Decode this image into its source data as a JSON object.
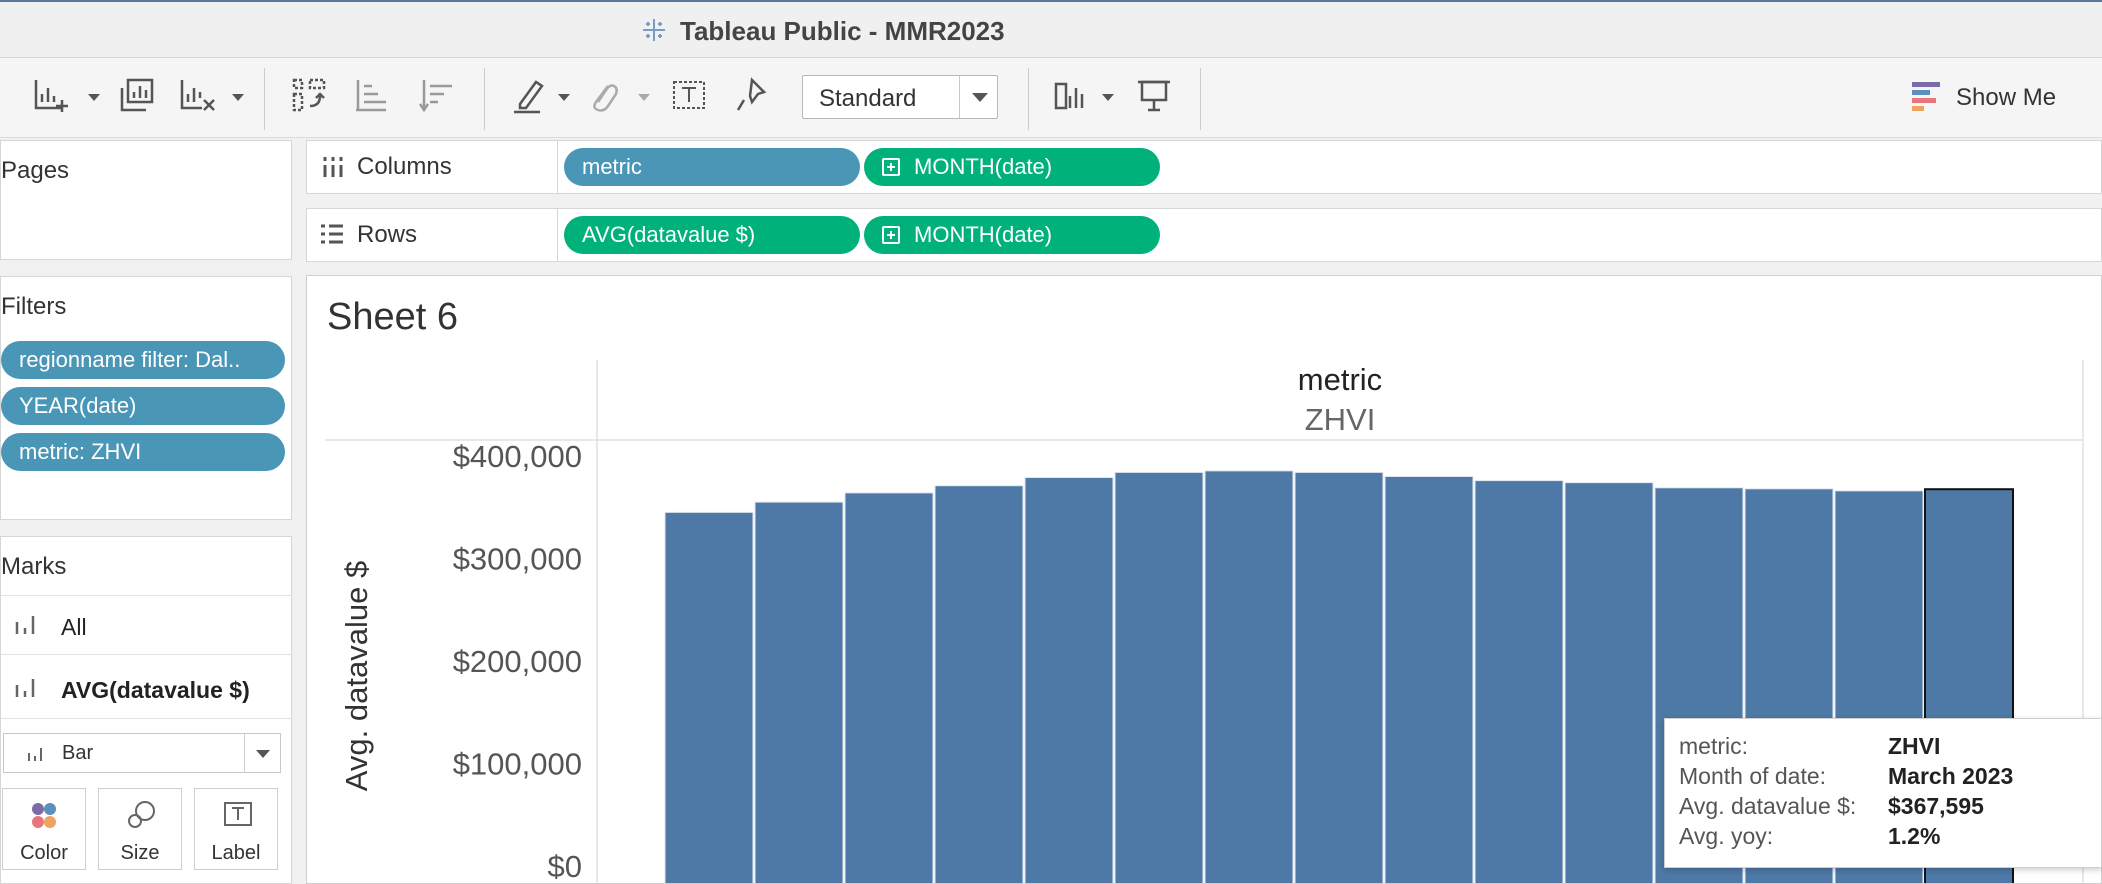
{
  "window": {
    "title": "Tableau Public - MMR2023"
  },
  "toolbar": {
    "view_select": "Standard",
    "show_me_label": "Show Me"
  },
  "left": {
    "pages_title": "Pages",
    "filters_title": "Filters",
    "filters": [
      "regionname filter: Dal..",
      "YEAR(date)",
      "metric: ZHVI"
    ],
    "marks_title": "Marks",
    "marks_rows": [
      "All",
      "AVG(datavalue $)"
    ],
    "mark_type": "Bar",
    "mark_cards": [
      "Color",
      "Size",
      "Label"
    ]
  },
  "shelves": {
    "columns_label": "Columns",
    "columns_pills": [
      "metric",
      "MONTH(date)"
    ],
    "rows_label": "Rows",
    "rows_pills": [
      "AVG(datavalue $)",
      "MONTH(date)"
    ]
  },
  "sheet": {
    "title": "Sheet 6",
    "header_field": "metric",
    "header_value": "ZHVI"
  },
  "chart_data": {
    "type": "bar",
    "title": "",
    "ylabel": "Avg. datavalue $",
    "ylim": [
      0,
      400000
    ],
    "yticks": [
      "$400,000",
      "$300,000",
      "$200,000",
      "$100,000",
      "$0"
    ],
    "series": [
      {
        "values": [
          345000,
          355000,
          364000,
          371000,
          379000,
          384000,
          385500,
          384000,
          380000,
          376000,
          374000,
          369000,
          368000,
          366000,
          367595
        ]
      }
    ],
    "highlighted_index": 14,
    "bar_color": "#4e79a7"
  },
  "tooltip": {
    "rows": [
      {
        "k": "metric:",
        "v": "ZHVI"
      },
      {
        "k": "Month of date:",
        "v": "March 2023"
      },
      {
        "k": "Avg. datavalue $:",
        "v": "$367,595"
      },
      {
        "k": "Avg. yoy:",
        "v": "1.2%"
      }
    ]
  }
}
